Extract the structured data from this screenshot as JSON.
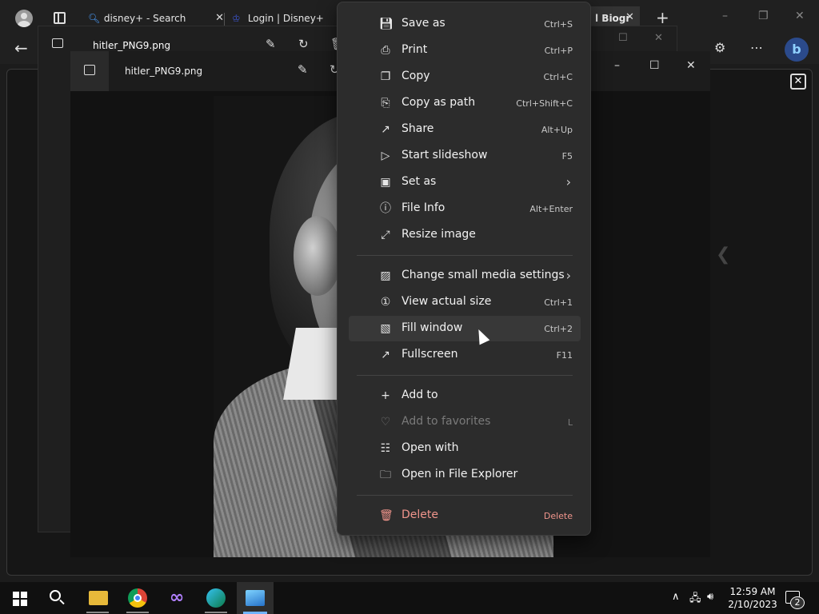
{
  "browser": {
    "tabs": [
      {
        "title": "disney+ - Search",
        "icon": "search-icon"
      },
      {
        "title": "Login | Disney+",
        "icon": "disney-plus-icon"
      },
      {
        "title": "l Biogr",
        "icon": "page-icon"
      }
    ],
    "close_glyph": "✕",
    "new_tab_glyph": "+"
  },
  "photos_back": {
    "filename": "hitler_PNG9.png"
  },
  "photos_front": {
    "filename": "hitler_PNG9.png"
  },
  "context_menu": {
    "groups": [
      [
        {
          "label": "Save as",
          "shortcut": "Ctrl+S",
          "icon": "save-icon"
        },
        {
          "label": "Print",
          "shortcut": "Ctrl+P",
          "icon": "print-icon"
        },
        {
          "label": "Copy",
          "shortcut": "Ctrl+C",
          "icon": "copy-icon"
        },
        {
          "label": "Copy as path",
          "shortcut": "Ctrl+Shift+C",
          "icon": "copy-path-icon"
        },
        {
          "label": "Share",
          "shortcut": "Alt+Up",
          "icon": "share-icon"
        },
        {
          "label": "Start slideshow",
          "shortcut": "F5",
          "icon": "slideshow-icon"
        },
        {
          "label": "Set as",
          "shortcut": "",
          "icon": "set-as-icon",
          "submenu": true
        },
        {
          "label": "File Info",
          "shortcut": "Alt+Enter",
          "icon": "info-icon"
        },
        {
          "label": "Resize image",
          "shortcut": "",
          "icon": "resize-icon"
        }
      ],
      [
        {
          "label": "Change small media settings",
          "shortcut": "",
          "icon": "media-settings-icon",
          "submenu": true
        },
        {
          "label": "View actual size",
          "shortcut": "Ctrl+1",
          "icon": "actual-size-icon"
        },
        {
          "label": "Fill window",
          "shortcut": "Ctrl+2",
          "icon": "fill-window-icon",
          "hover": true
        },
        {
          "label": "Fullscreen",
          "shortcut": "F11",
          "icon": "fullscreen-icon"
        }
      ],
      [
        {
          "label": "Add to",
          "shortcut": "",
          "icon": "add-icon"
        },
        {
          "label": "Add to favorites",
          "shortcut": "L",
          "icon": "heart-icon",
          "disabled": true
        },
        {
          "label": "Open with",
          "shortcut": "",
          "icon": "open-with-icon"
        },
        {
          "label": "Open in File Explorer",
          "shortcut": "",
          "icon": "folder-icon"
        }
      ],
      [
        {
          "label": "Delete",
          "shortcut": "Delete",
          "icon": "trash-icon",
          "danger": true
        }
      ]
    ]
  },
  "taskbar": {
    "apps": [
      "windows-start-icon",
      "search-icon",
      "file-explorer-icon",
      "chrome-icon",
      "visual-studio-icon",
      "edge-dev-icon",
      "photos-icon"
    ],
    "time": "12:59 AM",
    "date": "2/10/2023",
    "notification_count": "2"
  },
  "colors": {
    "menu_bg": "#2c2c2c",
    "danger": "#f0958c",
    "accent": "#6fb3ff"
  }
}
